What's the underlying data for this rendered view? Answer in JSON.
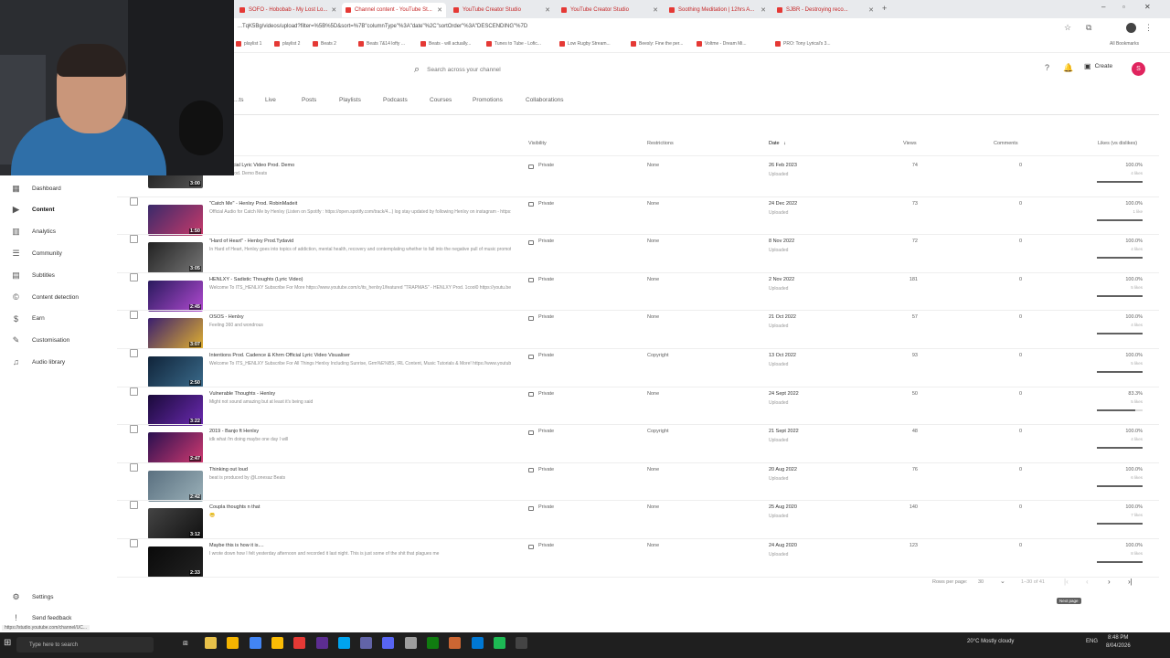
{
  "browser": {
    "tabs": [
      {
        "label": "SOFO - Hobobab - My Lost Lo...",
        "active": false
      },
      {
        "label": "Channel content - YouTube St...",
        "active": true
      },
      {
        "label": "YouTube Creator Studio",
        "active": false
      },
      {
        "label": "YouTube Creator Studio",
        "active": false
      },
      {
        "label": "Soothing Meditation | 12hrs A...",
        "active": false
      },
      {
        "label": "SJBR - Destroying reco...",
        "active": false
      }
    ],
    "url": "...TqK5Bg/videos/upload?filter=%5B%5D&sort=%7B\"columnType\"%3A\"date\"%2C\"sortOrder\"%3A\"DESCENDING\"%7D",
    "bookmarks": [
      "playlist 1",
      "playlist 2",
      "Beats 2",
      "Beats 7&14 lofty ...",
      "Beats - will actually...",
      "Tunes to Tube - Lofic...",
      "Low Rugby Stream...",
      "Beesly: Fine the per...",
      "Voltme - Dream Mi...",
      "PRO: Tony Lyrical's 3..."
    ],
    "all_bookmarks_label": "All Bookmarks"
  },
  "header": {
    "search_placeholder": "Search across your channel",
    "create_label": "Create",
    "avatar_letter": "S"
  },
  "content_tabs": [
    "...ts",
    "Live",
    "Posts",
    "Playlists",
    "Podcasts",
    "Courses",
    "Promotions",
    "Collaborations"
  ],
  "sidebar": {
    "items": [
      {
        "label": "Dashboard",
        "icon": "dashboard-icon",
        "glyph": "▦",
        "active": false
      },
      {
        "label": "Content",
        "icon": "content-icon",
        "glyph": "▶",
        "active": true
      },
      {
        "label": "Analytics",
        "icon": "analytics-icon",
        "glyph": "▥",
        "active": false
      },
      {
        "label": "Community",
        "icon": "community-icon",
        "glyph": "☰",
        "active": false
      },
      {
        "label": "Subtitles",
        "icon": "subtitles-icon",
        "glyph": "▤",
        "active": false
      },
      {
        "label": "Content detection",
        "icon": "copyright-icon",
        "glyph": "©",
        "active": false
      },
      {
        "label": "Earn",
        "icon": "earn-icon",
        "glyph": "$",
        "active": false
      },
      {
        "label": "Customisation",
        "icon": "customisation-icon",
        "glyph": "✎",
        "active": false
      },
      {
        "label": "Audio library",
        "icon": "audio-library-icon",
        "glyph": "♫",
        "active": false
      }
    ],
    "settings_label": "Settings",
    "feedback_label": "Send feedback"
  },
  "table": {
    "headers": {
      "visibility": "Visibility",
      "restrictions": "Restrictions",
      "date": "Date",
      "views": "Views",
      "comments": "Comments",
      "likes": "Likes (vs dislikes)"
    },
    "rows": [
      {
        "title": "...me - Official Lyric Video Prod. Demo",
        "desc": "...image - Prod. Demo Beats",
        "duration": "3:00",
        "visibility": "Private",
        "restrictions": "None",
        "date": "26 Feb 2023",
        "date_sub": "Uploaded",
        "views": "74",
        "comments": "0",
        "likes": "100.0%",
        "likes_sub": "4 likes",
        "like_fraction": 1.0,
        "colors": [
          "#1b1b1b",
          "#555"
        ]
      },
      {
        "title": "\"Catch Me\" - Henlxy Prod. RobinMadeit",
        "desc": "Official Audio for Catch Me by Henlxy (Listen on Spotify : https://open.spotify.com/track/4...) log stay updated by following Henlxy on instagram - https://www.instagram.com/its_henlx...",
        "duration": "1:50",
        "visibility": "Private",
        "restrictions": "None",
        "date": "24 Dec 2022",
        "date_sub": "Uploaded",
        "views": "73",
        "comments": "0",
        "likes": "100.0%",
        "likes_sub": "1 like",
        "like_fraction": 1.0,
        "colors": [
          "#3a2a6a",
          "#c83a6a"
        ]
      },
      {
        "title": "\"Hard of Heart\" - Henlxy Prod.Tydavid",
        "desc": "In Hard of Heart, Henlxy goes into topics of addiction, mental health, recovery and contemplating whether to fall into the negative pull of music promoting materialism, sex, drugs or money. Henlxy brings a societal approach, but still come rise",
        "duration": "3:05",
        "visibility": "Private",
        "restrictions": "None",
        "date": "8 Nov 2022",
        "date_sub": "Uploaded",
        "views": "72",
        "comments": "0",
        "likes": "100.0%",
        "likes_sub": "4 likes",
        "like_fraction": 1.0,
        "colors": [
          "#222",
          "#777"
        ]
      },
      {
        "title": "HENLXY - Sadistic Thoughts (Lyric Video)",
        "desc": "Welcome To ITS_HENLXY Subscribe For More https://www.youtube.com/c/its_henlxy1/featured \"TRAPMAS\" - HENLXY Prod. 1cool0 https://youtu.be/xONE_KrusA \"JERSEY CHRISTMAS\" - HENLXY...",
        "duration": "2:45",
        "visibility": "Private",
        "restrictions": "None",
        "date": "2 Nov 2022",
        "date_sub": "Uploaded",
        "views": "181",
        "comments": "0",
        "likes": "100.0%",
        "likes_sub": "5 likes",
        "like_fraction": 1.0,
        "colors": [
          "#2a1a5e",
          "#b04ad0"
        ]
      },
      {
        "title": "OSOS - Henlxy",
        "desc": "Feeling 360 and wondrous",
        "duration": "3:07",
        "visibility": "Private",
        "restrictions": "None",
        "date": "21 Oct 2022",
        "date_sub": "Uploaded",
        "views": "57",
        "comments": "0",
        "likes": "100.0%",
        "likes_sub": "4 likes",
        "like_fraction": 1.0,
        "colors": [
          "#3b1f6e",
          "#e0b030"
        ]
      },
      {
        "title": "Intentions Prod. Cadence & Khrm Official Lyric Video Visualiser",
        "desc": "Welcome To ITS_HENLXY Subscribe For All Things Henlxy Including Sunrise, Grm%E%BS, IRL Content, Music Tutorials & More! https://www.youtube.com/c/its_henlxy33 \"Catch Me\" - Henlxy Prod. RobinMadeit",
        "duration": "2:50",
        "visibility": "Private",
        "restrictions": "Copyright",
        "date": "13 Oct 2022",
        "date_sub": "Uploaded",
        "views": "93",
        "comments": "0",
        "likes": "100.0%",
        "likes_sub": "5 likes",
        "like_fraction": 1.0,
        "colors": [
          "#10243a",
          "#3a6a8a"
        ]
      },
      {
        "title": "Vulnerable Thoughts - Henlxy",
        "desc": "Might not sound amazing but at least it's being said",
        "duration": "3:22",
        "visibility": "Private",
        "restrictions": "None",
        "date": "24 Sept 2022",
        "date_sub": "Uploaded",
        "views": "50",
        "comments": "0",
        "likes": "83.3%",
        "likes_sub": "5 likes",
        "like_fraction": 0.833,
        "colors": [
          "#1a0a3a",
          "#6a2ab0"
        ]
      },
      {
        "title": "2019 - Banjo ft Henlxy",
        "desc": "idk what i'm doing maybe one day I will",
        "duration": "2:47",
        "visibility": "Private",
        "restrictions": "Copyright",
        "date": "21 Sept 2022",
        "date_sub": "Uploaded",
        "views": "48",
        "comments": "0",
        "likes": "100.0%",
        "likes_sub": "4 likes",
        "like_fraction": 1.0,
        "colors": [
          "#2a1050",
          "#d03a70"
        ]
      },
      {
        "title": "Thinking out loud",
        "desc": "beat is produced by @Lonesaz Beats",
        "duration": "2:42",
        "visibility": "Private",
        "restrictions": "None",
        "date": "20 Aug 2022",
        "date_sub": "Uploaded",
        "views": "76",
        "comments": "0",
        "likes": "100.0%",
        "likes_sub": "6 likes",
        "like_fraction": 1.0,
        "colors": [
          "#5a7080",
          "#9ab0b8"
        ]
      },
      {
        "title": "Coupla thoughts n that",
        "desc": "😬",
        "duration": "3:12",
        "visibility": "Private",
        "restrictions": "None",
        "date": "25 Aug 2020",
        "date_sub": "Uploaded",
        "views": "140",
        "comments": "0",
        "likes": "100.0%",
        "likes_sub": "7 likes",
        "like_fraction": 1.0,
        "colors": [
          "#444",
          "#111"
        ]
      },
      {
        "title": "Maybe this is how it is....",
        "desc": "I wrote down how I felt yesterday afternoon and recorded it last night. This is just some of the shit that plagues me",
        "duration": "2:33",
        "visibility": "Private",
        "restrictions": "None",
        "date": "24 Aug 2020",
        "date_sub": "Uploaded",
        "views": "123",
        "comments": "0",
        "likes": "100.0%",
        "likes_sub": "8 likes",
        "like_fraction": 1.0,
        "colors": [
          "#0a0a0a",
          "#222"
        ]
      }
    ]
  },
  "pagination": {
    "rows_per_page_label": "Rows per page:",
    "rows_per_page": "30",
    "range": "1–30 of 41",
    "tooltip": "Next page"
  },
  "status_url": "https://studio.youtube.com/channel/UC...",
  "taskbar": {
    "search_placeholder": "Type here to search",
    "weather": "20°C  Mostly cloudy",
    "lang": "ENG",
    "time": "8:48 PM",
    "date": "8/04/2026"
  }
}
